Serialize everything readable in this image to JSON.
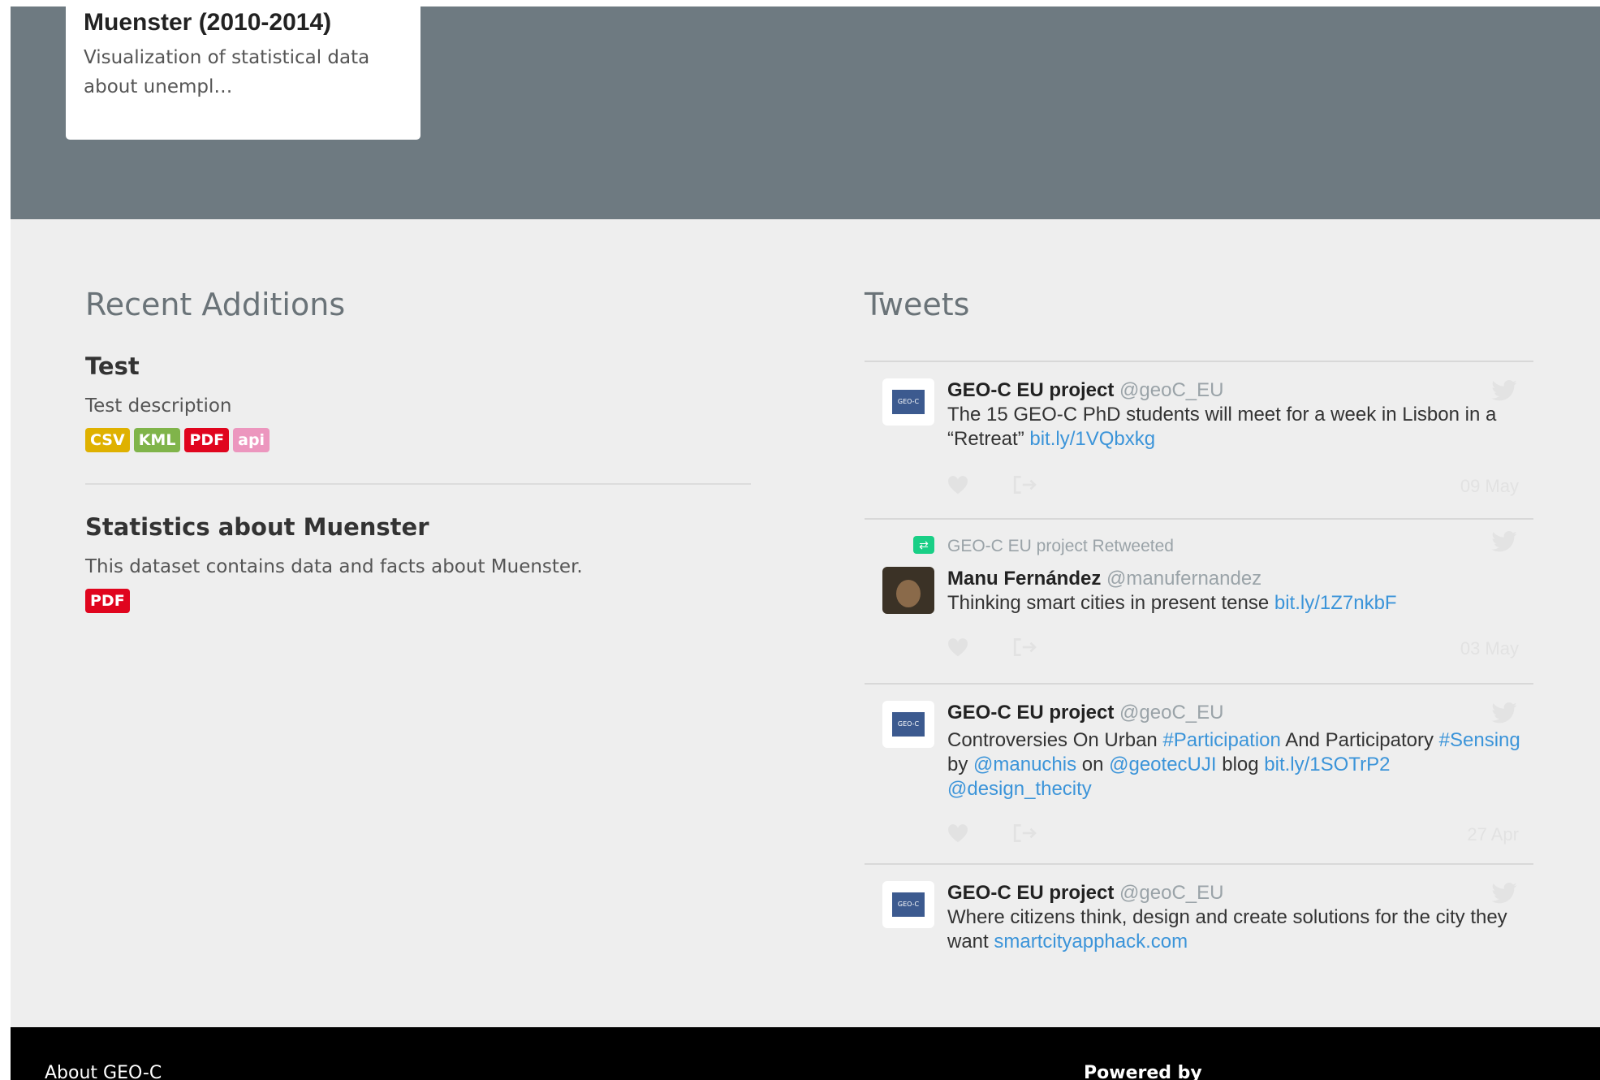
{
  "hero": {
    "card_title": "Muenster (2010-2014)",
    "card_description": "Visualization of statistical data about unempl…"
  },
  "recent": {
    "title": "Recent Additions",
    "datasets": [
      {
        "title": "Test",
        "description": "Test description",
        "formats": [
          "CSV",
          "KML",
          "PDF",
          "api"
        ]
      },
      {
        "title": "Statistics about Muenster",
        "description": "This dataset contains data and facts about Muenster.",
        "formats": [
          "PDF"
        ]
      }
    ]
  },
  "tweets": {
    "title": "Tweets",
    "items": [
      {
        "name": "GEO-C EU project",
        "handle": "@geoC_EU",
        "text_before": "The 15 GEO-C PhD students will meet for a week in Lisbon in a “Retreat” ",
        "link": "bit.ly/1VQbxkg",
        "date": "09 May"
      },
      {
        "retweeted_by": "GEO-C EU project Retweeted",
        "name": "Manu Fernández",
        "handle": "@manufernandez",
        "text_before": "Thinking smart cities in present tense ",
        "link": "bit.ly/1Z7nkbF",
        "date": "03 May"
      },
      {
        "name": "GEO-C EU project",
        "handle": "@geoC_EU",
        "parts": [
          "Controversies On Urban ",
          "#Participation",
          " And Participatory ",
          "#Sensing",
          " by ",
          "@manuchis",
          " on ",
          "@geotecUJI",
          " blog ",
          "bit.ly/1SOTrP2",
          " ",
          "@design_thecity"
        ],
        "date": "27 Apr"
      },
      {
        "name": "GEO-C EU project",
        "handle": "@geoC_EU",
        "text_before": "Where citizens think, design and create solutions for the city they want ",
        "link": "smartcityapphack.com"
      }
    ]
  },
  "footer": {
    "about": "About GEO-C",
    "powered_by": "Powered by"
  },
  "icons": {
    "avatar_logo_text": "GEO-C",
    "retweet_icon": "retweet-icon",
    "like_icon": "heart-icon",
    "share_icon": "share-icon",
    "twitter_icon": "twitter-bird-icon"
  },
  "colors": {
    "hero_bg": "#6e7a81",
    "link": "#3b94d9",
    "csv": "#dfb100",
    "kml": "#80b44a",
    "pdf": "#e0051e",
    "api": "#ec96be",
    "retweet": "#19cf86"
  }
}
